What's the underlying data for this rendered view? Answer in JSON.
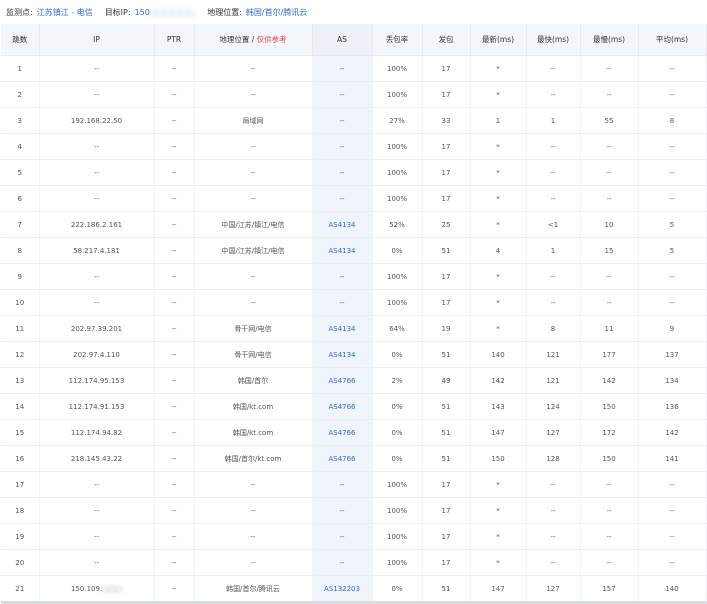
{
  "header": {
    "monitor_label": "监测点:",
    "monitor_value": "江苏镇江 - 电信",
    "target_label": "目标IP:",
    "target_value": "150",
    "target_masked": "□□□□□□",
    "location_label": "地理位置:",
    "location_value": "韩国/首尔/腾讯云"
  },
  "columns": {
    "hop": "跳数",
    "ip": "IP",
    "ptr": "PTR",
    "geo_prefix": "地理位置 / ",
    "geo_note": "仅供参考",
    "as": "AS",
    "loss": "丢包率",
    "sent": "发包",
    "latest": "最新(ms)",
    "best": "最快(ms)",
    "worst": "最慢(ms)",
    "avg": "平均(ms)"
  },
  "rows": [
    {
      "hop": "1",
      "ip": "--",
      "ptr": "--",
      "geo": "--",
      "as": "--",
      "loss": "100%",
      "sent": "17",
      "latest": "*",
      "best": "--",
      "worst": "--",
      "avg": "--"
    },
    {
      "hop": "2",
      "ip": "--",
      "ptr": "--",
      "geo": "--",
      "as": "--",
      "loss": "100%",
      "sent": "17",
      "latest": "*",
      "best": "--",
      "worst": "--",
      "avg": "--"
    },
    {
      "hop": "3",
      "ip": "192.168.22.50",
      "ptr": "--",
      "geo": "局域网",
      "as": "--",
      "loss": "27%",
      "sent": "33",
      "latest": "1",
      "best": "1",
      "worst": "55",
      "avg": "8"
    },
    {
      "hop": "4",
      "ip": "--",
      "ptr": "--",
      "geo": "--",
      "as": "--",
      "loss": "100%",
      "sent": "17",
      "latest": "*",
      "best": "--",
      "worst": "--",
      "avg": "--"
    },
    {
      "hop": "5",
      "ip": "--",
      "ptr": "--",
      "geo": "--",
      "as": "--",
      "loss": "100%",
      "sent": "17",
      "latest": "*",
      "best": "--",
      "worst": "--",
      "avg": "--"
    },
    {
      "hop": "6",
      "ip": "--",
      "ptr": "--",
      "geo": "--",
      "as": "--",
      "loss": "100%",
      "sent": "17",
      "latest": "*",
      "best": "--",
      "worst": "--",
      "avg": "--"
    },
    {
      "hop": "7",
      "ip": "222.186.2.161",
      "ptr": "--",
      "geo": "中国/江苏/镇江/电信",
      "as": "AS4134",
      "loss": "52%",
      "sent": "25",
      "latest": "*",
      "best": "<1",
      "worst": "10",
      "avg": "5"
    },
    {
      "hop": "8",
      "ip": "58.217.4.181",
      "ptr": "--",
      "geo": "中国/江苏/镇江/电信",
      "as": "AS4134",
      "loss": "0%",
      "sent": "51",
      "latest": "4",
      "best": "1",
      "worst": "15",
      "avg": "5"
    },
    {
      "hop": "9",
      "ip": "--",
      "ptr": "--",
      "geo": "--",
      "as": "--",
      "loss": "100%",
      "sent": "17",
      "latest": "*",
      "best": "--",
      "worst": "--",
      "avg": "--"
    },
    {
      "hop": "10",
      "ip": "--",
      "ptr": "--",
      "geo": "--",
      "as": "--",
      "loss": "100%",
      "sent": "17",
      "latest": "*",
      "best": "--",
      "worst": "--",
      "avg": "--"
    },
    {
      "hop": "11",
      "ip": "202.97.39.201",
      "ptr": "--",
      "geo": "骨干网/电信",
      "as": "AS4134",
      "loss": "64%",
      "sent": "19",
      "latest": "*",
      "best": "8",
      "worst": "11",
      "avg": "9"
    },
    {
      "hop": "12",
      "ip": "202.97.4.110",
      "ptr": "--",
      "geo": "骨干网/电信",
      "as": "AS4134",
      "loss": "0%",
      "sent": "51",
      "latest": "140",
      "best": "121",
      "worst": "177",
      "avg": "137"
    },
    {
      "hop": "13",
      "ip": "112.174.95.153",
      "ptr": "--",
      "geo": "韩国/首尔",
      "as": "AS4766",
      "loss": "2%",
      "sent": "49",
      "latest": "142",
      "best": "121",
      "worst": "142",
      "avg": "134"
    },
    {
      "hop": "14",
      "ip": "112.174.91.153",
      "ptr": "--",
      "geo": "韩国/kt.com",
      "as": "AS4766",
      "loss": "0%",
      "sent": "51",
      "latest": "143",
      "best": "124",
      "worst": "150",
      "avg": "136"
    },
    {
      "hop": "15",
      "ip": "112.174.94.82",
      "ptr": "--",
      "geo": "韩国/kt.com",
      "as": "AS4766",
      "loss": "0%",
      "sent": "51",
      "latest": "147",
      "best": "127",
      "worst": "172",
      "avg": "142"
    },
    {
      "hop": "16",
      "ip": "218.145.43.22",
      "ptr": "--",
      "geo": "韩国/首尔/kt.com",
      "as": "AS4766",
      "loss": "0%",
      "sent": "51",
      "latest": "150",
      "best": "128",
      "worst": "150",
      "avg": "141"
    },
    {
      "hop": "17",
      "ip": "--",
      "ptr": "--",
      "geo": "--",
      "as": "--",
      "loss": "100%",
      "sent": "17",
      "latest": "*",
      "best": "--",
      "worst": "--",
      "avg": "--"
    },
    {
      "hop": "18",
      "ip": "--",
      "ptr": "--",
      "geo": "--",
      "as": "--",
      "loss": "100%",
      "sent": "17",
      "latest": "*",
      "best": "--",
      "worst": "--",
      "avg": "--"
    },
    {
      "hop": "19",
      "ip": "--",
      "ptr": "--",
      "geo": "--",
      "as": "--",
      "loss": "100%",
      "sent": "17",
      "latest": "*",
      "best": "--",
      "worst": "--",
      "avg": "--"
    },
    {
      "hop": "20",
      "ip": "--",
      "ptr": "--",
      "geo": "--",
      "as": "--",
      "loss": "100%",
      "sent": "17",
      "latest": "*",
      "best": "--",
      "worst": "--",
      "avg": "--"
    },
    {
      "hop": "21",
      "ip": "150.109.",
      "ip_masked": "□□□",
      "ptr": "--",
      "geo": "韩国/首尔/腾讯云",
      "as": "AS132203",
      "loss": "0%",
      "sent": "51",
      "latest": "147",
      "best": "127",
      "worst": "157",
      "avg": "140"
    }
  ]
}
